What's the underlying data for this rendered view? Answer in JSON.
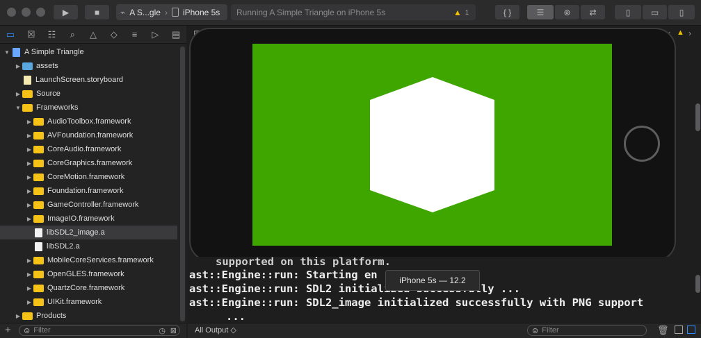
{
  "toolbar": {
    "scheme_project": "A S...gle",
    "scheme_device": "iPhone 5s",
    "status_text": "Running A Simple Triangle on iPhone 5s",
    "warning_count": "1",
    "play_glyph": "▶",
    "stop_glyph": "■",
    "code_glyph": "{ }"
  },
  "navigator": {
    "tabs": [
      "folder-icon",
      "source-control-icon",
      "hierarchy-icon",
      "search-icon",
      "warning-icon",
      "test-icon",
      "debug-icon",
      "breakpoint-icon",
      "report-icon"
    ],
    "filter_placeholder": "Filter",
    "items": [
      {
        "label": "A Simple Triangle",
        "depth": 0,
        "kind": "project",
        "disclosure": "▼"
      },
      {
        "label": "assets",
        "depth": 1,
        "kind": "folder-blue",
        "disclosure": "▶"
      },
      {
        "label": "LaunchScreen.storyboard",
        "depth": 1,
        "kind": "storyboard",
        "disclosure": ""
      },
      {
        "label": "Source",
        "depth": 1,
        "kind": "folder",
        "disclosure": "▶"
      },
      {
        "label": "Frameworks",
        "depth": 1,
        "kind": "folder",
        "disclosure": "▼"
      },
      {
        "label": "AudioToolbox.framework",
        "depth": 2,
        "kind": "framework",
        "disclosure": "▶"
      },
      {
        "label": "AVFoundation.framework",
        "depth": 2,
        "kind": "framework",
        "disclosure": "▶"
      },
      {
        "label": "CoreAudio.framework",
        "depth": 2,
        "kind": "framework",
        "disclosure": "▶"
      },
      {
        "label": "CoreGraphics.framework",
        "depth": 2,
        "kind": "framework",
        "disclosure": "▶"
      },
      {
        "label": "CoreMotion.framework",
        "depth": 2,
        "kind": "framework",
        "disclosure": "▶"
      },
      {
        "label": "Foundation.framework",
        "depth": 2,
        "kind": "framework",
        "disclosure": "▶"
      },
      {
        "label": "GameController.framework",
        "depth": 2,
        "kind": "framework",
        "disclosure": "▶"
      },
      {
        "label": "ImageIO.framework",
        "depth": 2,
        "kind": "framework",
        "disclosure": "▶"
      },
      {
        "label": "libSDL2_image.a",
        "depth": 2,
        "kind": "file",
        "disclosure": "",
        "selected": true
      },
      {
        "label": "libSDL2.a",
        "depth": 2,
        "kind": "file",
        "disclosure": ""
      },
      {
        "label": "MobileCoreServices.framework",
        "depth": 2,
        "kind": "framework",
        "disclosure": "▶"
      },
      {
        "label": "OpenGLES.framework",
        "depth": 2,
        "kind": "framework",
        "disclosure": "▶"
      },
      {
        "label": "QuartzCore.framework",
        "depth": 2,
        "kind": "framework",
        "disclosure": "▶"
      },
      {
        "label": "UIKit.framework",
        "depth": 2,
        "kind": "framework",
        "disclosure": "▶"
      },
      {
        "label": "Products",
        "depth": 1,
        "kind": "folder",
        "disclosure": "▶"
      }
    ]
  },
  "simulator": {
    "tooltip": "iPhone 5s — 12.2",
    "screen_color": "#3fa600",
    "shape_color": "#ffffff"
  },
  "console": {
    "lines": [
      "supported on this platform.",
      "ast::Engine::run: Starting en",
      "ast::Engine::run: SDL2 initialized successfully ...",
      "ast::Engine::run: SDL2_image initialized successfully with PNG support",
      "..."
    ],
    "output_selector": "All Output ◇",
    "filter_placeholder": "Filter"
  },
  "colors": {
    "accent": "#2f8cff",
    "folder": "#f5c317",
    "folder_blue": "#5aa7e0",
    "warning": "#f0c000"
  }
}
